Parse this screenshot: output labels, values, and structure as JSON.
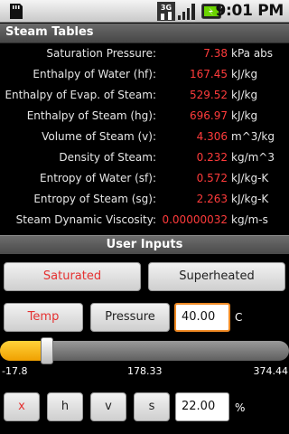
{
  "status_bar": {
    "time": "9:01 PM",
    "network_label": "3G",
    "icons": [
      "sd-card-icon",
      "3g-icon",
      "signal-icon",
      "battery-icon"
    ]
  },
  "app": {
    "title": "Steam Tables"
  },
  "results": [
    {
      "label": "Saturation Pressure:",
      "value": "7.38",
      "unit": "kPa abs"
    },
    {
      "label": "Enthalpy of Water (hf):",
      "value": "167.45",
      "unit": "kJ/kg"
    },
    {
      "label": "Enthalpy of Evap. of Steam:",
      "value": "529.52",
      "unit": "kJ/kg"
    },
    {
      "label": "Enthalpy of Steam (hg):",
      "value": "696.97",
      "unit": "kJ/kg"
    },
    {
      "label": "Volume of Steam (v):",
      "value": "4.306",
      "unit": "m^3/kg"
    },
    {
      "label": "Density of Steam:",
      "value": "0.232",
      "unit": "kg/m^3"
    },
    {
      "label": "Entropy of Water (sf):",
      "value": "0.572",
      "unit": "kJ/kg-K"
    },
    {
      "label": "Entropy of Steam (sg):",
      "value": "2.263",
      "unit": "kJ/kg-K"
    },
    {
      "label": "Steam Dynamic Viscosity:",
      "value": "0.00000032",
      "unit": "kg/m-s"
    }
  ],
  "inputs": {
    "section_title": "User Inputs",
    "mode_buttons": {
      "saturated": "Saturated",
      "superheated": "Superheated"
    },
    "type_buttons": {
      "temp": "Temp",
      "pressure": "Pressure"
    },
    "value": "40.00",
    "value_unit": "C",
    "slider": {
      "min": "-17.8",
      "mid": "178.33",
      "max": "374.44",
      "fraction": 0.148
    },
    "prop_buttons": {
      "x": "x",
      "h": "h",
      "v": "v",
      "s": "s"
    },
    "quality_value": "22.00",
    "quality_unit": "%"
  },
  "colors": {
    "accent": "#e53030",
    "value_red": "#ff3b3b",
    "focus_orange": "#f08a24",
    "slider_fill": "#f5b000"
  }
}
